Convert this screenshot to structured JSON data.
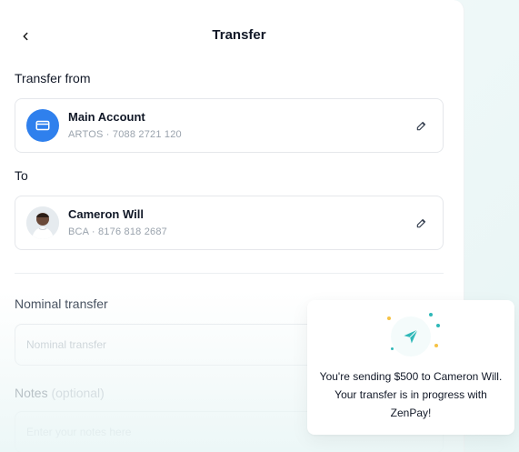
{
  "header": {
    "title": "Transfer"
  },
  "from": {
    "label": "Transfer from",
    "name": "Main Account",
    "detail": "ARTOS · 7088 2721 120"
  },
  "to": {
    "label": "To",
    "name": "Cameron Will",
    "detail": "BCA · 8176 818 2687"
  },
  "nominal": {
    "label": "Nominal transfer",
    "placeholder": "Nominal transfer"
  },
  "notes": {
    "label": "Notes",
    "optional": "(optional)",
    "placeholder": "Enter your notes here"
  },
  "toast": {
    "message": "You're sending $500 to Cameron Will. Your transfer is in progress with ZenPay!"
  },
  "colors": {
    "accent_blue": "#2f80ed",
    "teal": "#2fb8b8",
    "spark_yellow": "#f6c244"
  },
  "icons": {
    "back": "chevron-left-icon",
    "account": "card-icon",
    "edit": "pencil-icon",
    "send": "paper-plane-icon"
  }
}
